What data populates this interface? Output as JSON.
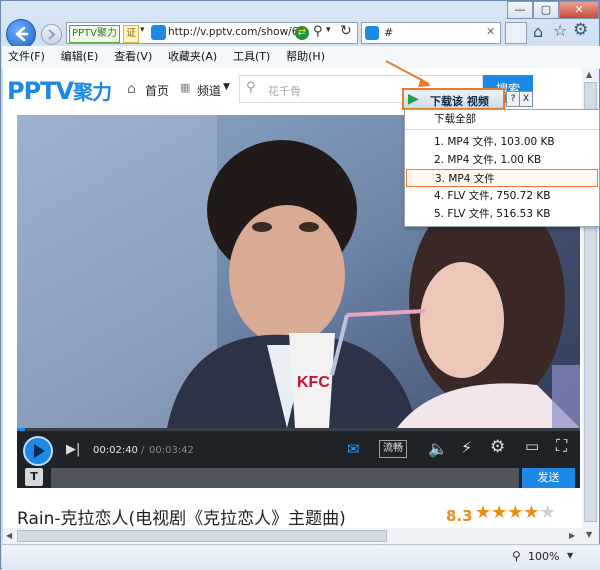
{
  "browser": {
    "address": {
      "site_badge": "PPTV聚力",
      "cert_badge": "证",
      "url": "http://v.pptv.com/show/6("
    },
    "tab": {
      "title": "#"
    },
    "menu": [
      "文件(F)",
      "编辑(E)",
      "查看(V)",
      "收藏夹(A)",
      "工具(T)",
      "帮助(H)"
    ],
    "zoom": "100%"
  },
  "site": {
    "logo_text": "PPTV",
    "logo_sub": "聚力",
    "nav_home": "首页",
    "nav_channel": "频道",
    "search_placeholder": "花千骨",
    "search_button": "搜索"
  },
  "downloader": {
    "button_label": "下载该 视频",
    "help": "?",
    "close": "X",
    "items": [
      "下载全部",
      "1.  MP4 文件,  103.00  KB",
      "2.  MP4 文件,  1.00  KB",
      "3.  MP4 文件",
      "4.  FLV 文件,  750.72  KB",
      "5.  FLV 文件,  516.53  KB"
    ]
  },
  "player": {
    "time_current": "00:02:40",
    "time_separator": "/",
    "time_total": "00:03:42",
    "quality": "流畅",
    "send_label": "发送",
    "progress": 0.015,
    "cup_text": "KFC"
  },
  "video_info": {
    "title": "Rain-克拉恋人(电视剧《克拉恋人》主题曲)",
    "rating": "8.3",
    "stars": 4
  },
  "colors": {
    "accent": "#1e88e5",
    "rating": "#f08c1f",
    "highlight_border": "#e87b2f"
  }
}
